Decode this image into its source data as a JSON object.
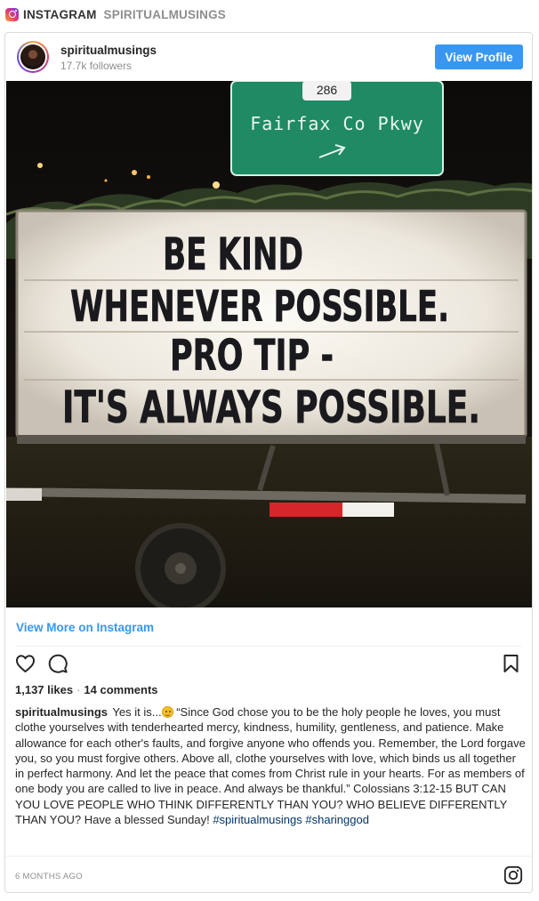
{
  "topbar": {
    "brand": "INSTAGRAM",
    "account": "SPIRITUALMUSINGS"
  },
  "post": {
    "username": "spiritualmusings",
    "followers": "17.7k followers",
    "view_profile_label": "View Profile",
    "photo": {
      "road_sign_number": "286",
      "road_sign_text": "Fairfax Co Pkwy",
      "sign_lines": [
        "BE KIND",
        "WHENEVER POSSIBLE.",
        "PRO TIP -",
        "IT'S ALWAYS POSSIBLE."
      ]
    },
    "view_more_label": "View More on Instagram",
    "likes": "1,137 likes",
    "separator": "·",
    "comments": "14 comments",
    "caption": {
      "username": "spiritualmusings",
      "text_before_emoji": "Yes it is...",
      "text_after_emoji": "“Since God chose you to be the holy people he loves, you must clothe yourselves with tenderhearted mercy, kindness, humility, gentleness, and patience. Make allowance for each other's faults, and forgive anyone who offends you. Remember, the Lord forgave you, so you must forgive others. Above all, clothe yourselves with love, which binds us all together in perfect harmony. And let the peace that comes from Christ rule in your hearts. For as members of one body you are called to live in peace. And always be thankful.” Colossians 3:12-15 BUT CAN YOU LOVE PEOPLE WHO THINK DIFFERENTLY THAN YOU? WHO BELIEVE DIFFERENTLY THAN YOU? Have a blessed Sunday!",
      "hashtags": [
        "#spiritualmusings",
        "#sharinggod"
      ]
    },
    "timestamp": "6 MONTHS AGO"
  },
  "colors": {
    "accent": "#3897f0",
    "text": "#262626",
    "muted": "#8e8e8e",
    "hashtag": "#003569",
    "road_sign": "#1f8a64"
  },
  "icons": [
    "instagram-logo-icon",
    "heart-icon",
    "comment-icon",
    "bookmark-icon",
    "instagram-glyph-icon",
    "smiling-emoji-icon"
  ]
}
